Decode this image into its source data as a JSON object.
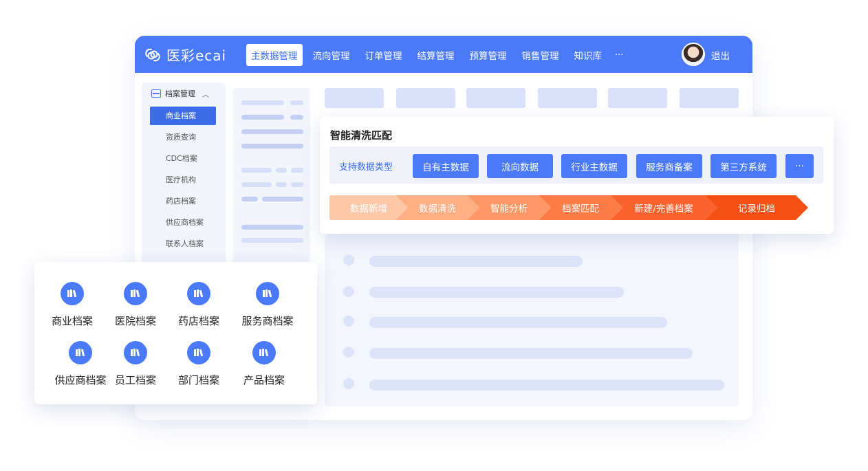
{
  "app": {
    "brand": "医彩ecai",
    "nav": [
      "主数据管理",
      "流向管理",
      "订单管理",
      "结算管理",
      "预算管理",
      "销售管理",
      "知识库"
    ],
    "nav_more": "···",
    "logout": "退出"
  },
  "sidebar": {
    "group": "档案管理",
    "items": [
      "商业档案",
      "资质查询",
      "CDC档案",
      "医疗机构",
      "药店档案",
      "供应商档案",
      "联系人档案"
    ]
  },
  "clean_card": {
    "title": "智能清洗匹配",
    "types_label": "支持数据类型",
    "types": [
      "自有主数据",
      "流向数据",
      "行业主数据",
      "服务商备案",
      "第三方系统"
    ],
    "types_more": "···",
    "steps": [
      "数据新增",
      "数据清洗",
      "智能分析",
      "档案匹配",
      "新建/完善档案",
      "记录归档"
    ]
  },
  "archive_card": {
    "items": [
      "商业档案",
      "医院档案",
      "药店档案",
      "服务商档案",
      "供应商档案",
      "员工档案",
      "部门档案",
      "产品档案"
    ]
  },
  "colors": {
    "primary": "#4a7af9",
    "steps": [
      "#fcc8a8",
      "#fdae83",
      "#fd9866",
      "#fc7b46",
      "#fa632e",
      "#f55014"
    ]
  }
}
